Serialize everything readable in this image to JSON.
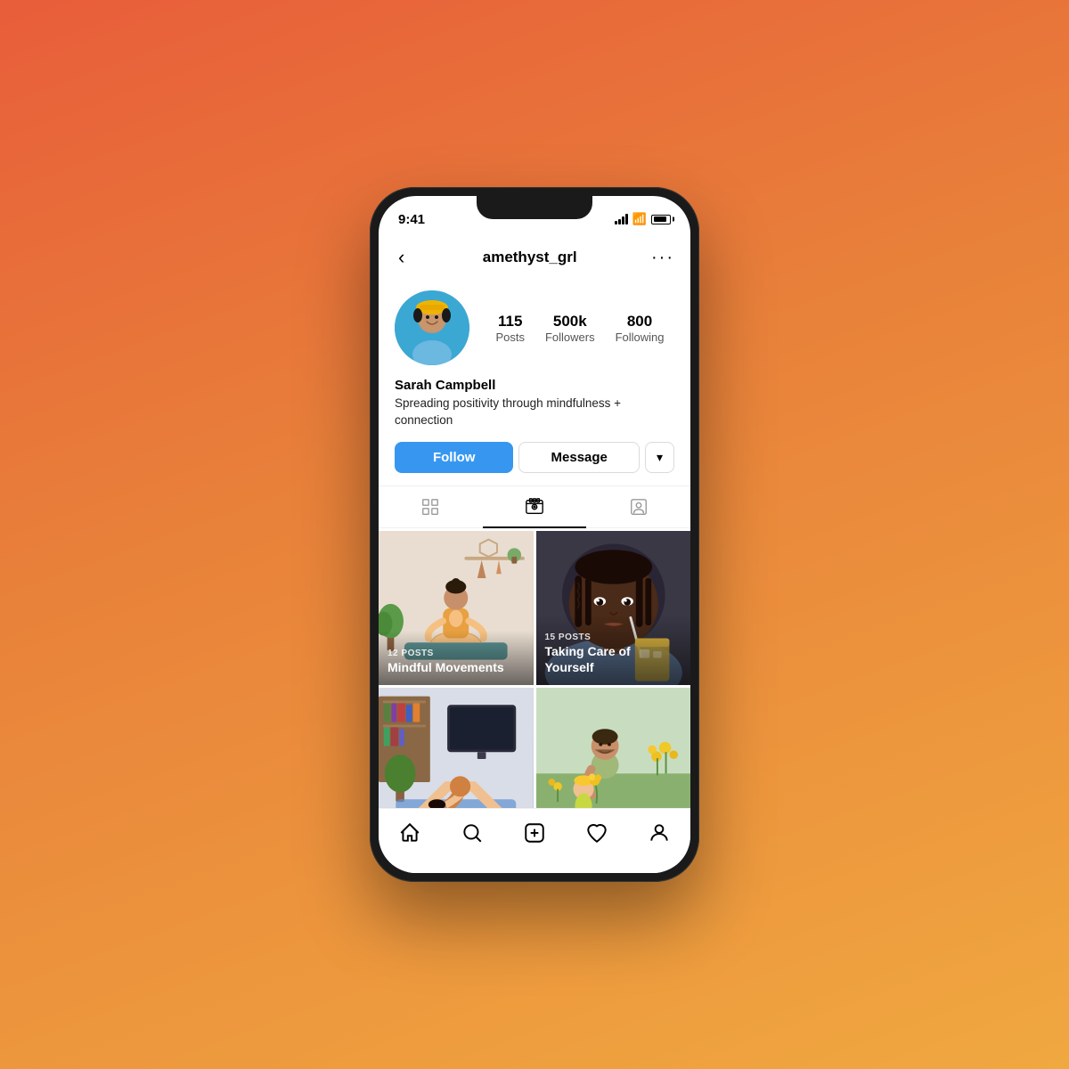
{
  "background": {
    "gradient": "linear-gradient(160deg, #e85d3a 0%, #e8803a 40%, #f0a840 100%)"
  },
  "statusBar": {
    "time": "9:41"
  },
  "header": {
    "backLabel": "‹",
    "username": "amethyst_grl",
    "moreLabel": "···"
  },
  "profile": {
    "name": "Sarah Campbell",
    "bio": "Spreading positivity through mindfulness + connection",
    "stats": {
      "posts": {
        "value": "115",
        "label": "Posts"
      },
      "followers": {
        "value": "500k",
        "label": "Followers"
      },
      "following": {
        "value": "800",
        "label": "Following"
      }
    }
  },
  "actions": {
    "follow": "Follow",
    "message": "Message",
    "dropdown": "▾"
  },
  "tabs": {
    "grid": "grid",
    "reels": "reels",
    "tagged": "tagged"
  },
  "posts": [
    {
      "postsCount": "12 POSTS",
      "title": "Mindful Movements",
      "sceneType": "yoga"
    },
    {
      "postsCount": "15 POSTS",
      "title": "Taking Care of Yourself",
      "sceneType": "drink"
    },
    {
      "postsCount": "",
      "title": "",
      "sceneType": "yoga2"
    },
    {
      "postsCount": "",
      "title": "",
      "sceneType": "garden"
    }
  ],
  "navBar": {
    "items": [
      "home",
      "search",
      "add",
      "heart",
      "profile"
    ]
  }
}
